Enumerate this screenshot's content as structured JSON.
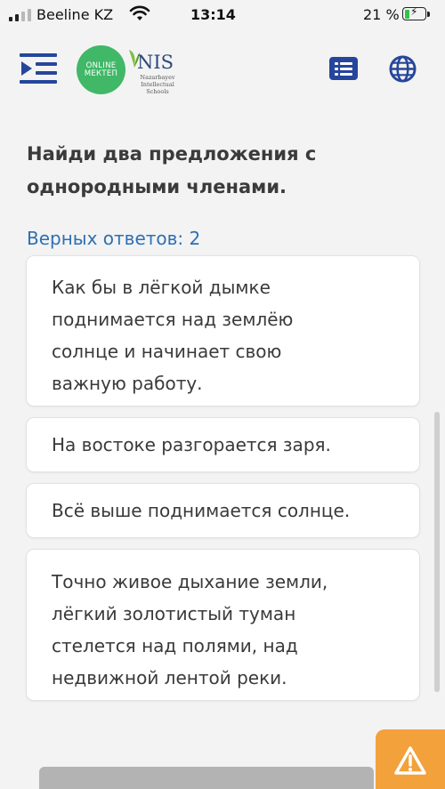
{
  "status_bar": {
    "carrier": "Beeline KZ",
    "time": "13:14",
    "battery": "21 %"
  },
  "header": {
    "logo_online_line1": "ONLINE",
    "logo_online_line2": "МЕКТЕП",
    "logo_nis_title": "NIS",
    "logo_nis_line1": "Nazarbayev",
    "logo_nis_line2": "Intellectual",
    "logo_nis_line3": "Schools"
  },
  "question": {
    "line1": "Найди два предложения с",
    "line2": "однородными членами.",
    "correct_count": "Верных ответов: 2"
  },
  "options": [
    {
      "lines": [
        "Как бы в лёгкой дымке",
        "поднимается над землёю",
        "солнце и начинает свою",
        "важную работу."
      ]
    },
    {
      "lines": [
        "На востоке разгорается заря."
      ]
    },
    {
      "lines": [
        "Всё выше поднимается солнце."
      ]
    },
    {
      "lines": [
        "Точно живое дыхание земли,",
        "лёгкий золотистый туман",
        "стелется над полями, над",
        "недвижной лентой реки."
      ]
    }
  ],
  "colors": {
    "accent": "#25469b",
    "correct_text": "#2f6fb2",
    "report": "#f3a13b",
    "logo_green": "#40b868"
  },
  "icons": [
    "menu-icon",
    "list-icon",
    "globe-icon",
    "warning-icon",
    "wifi-icon",
    "battery-icon"
  ]
}
